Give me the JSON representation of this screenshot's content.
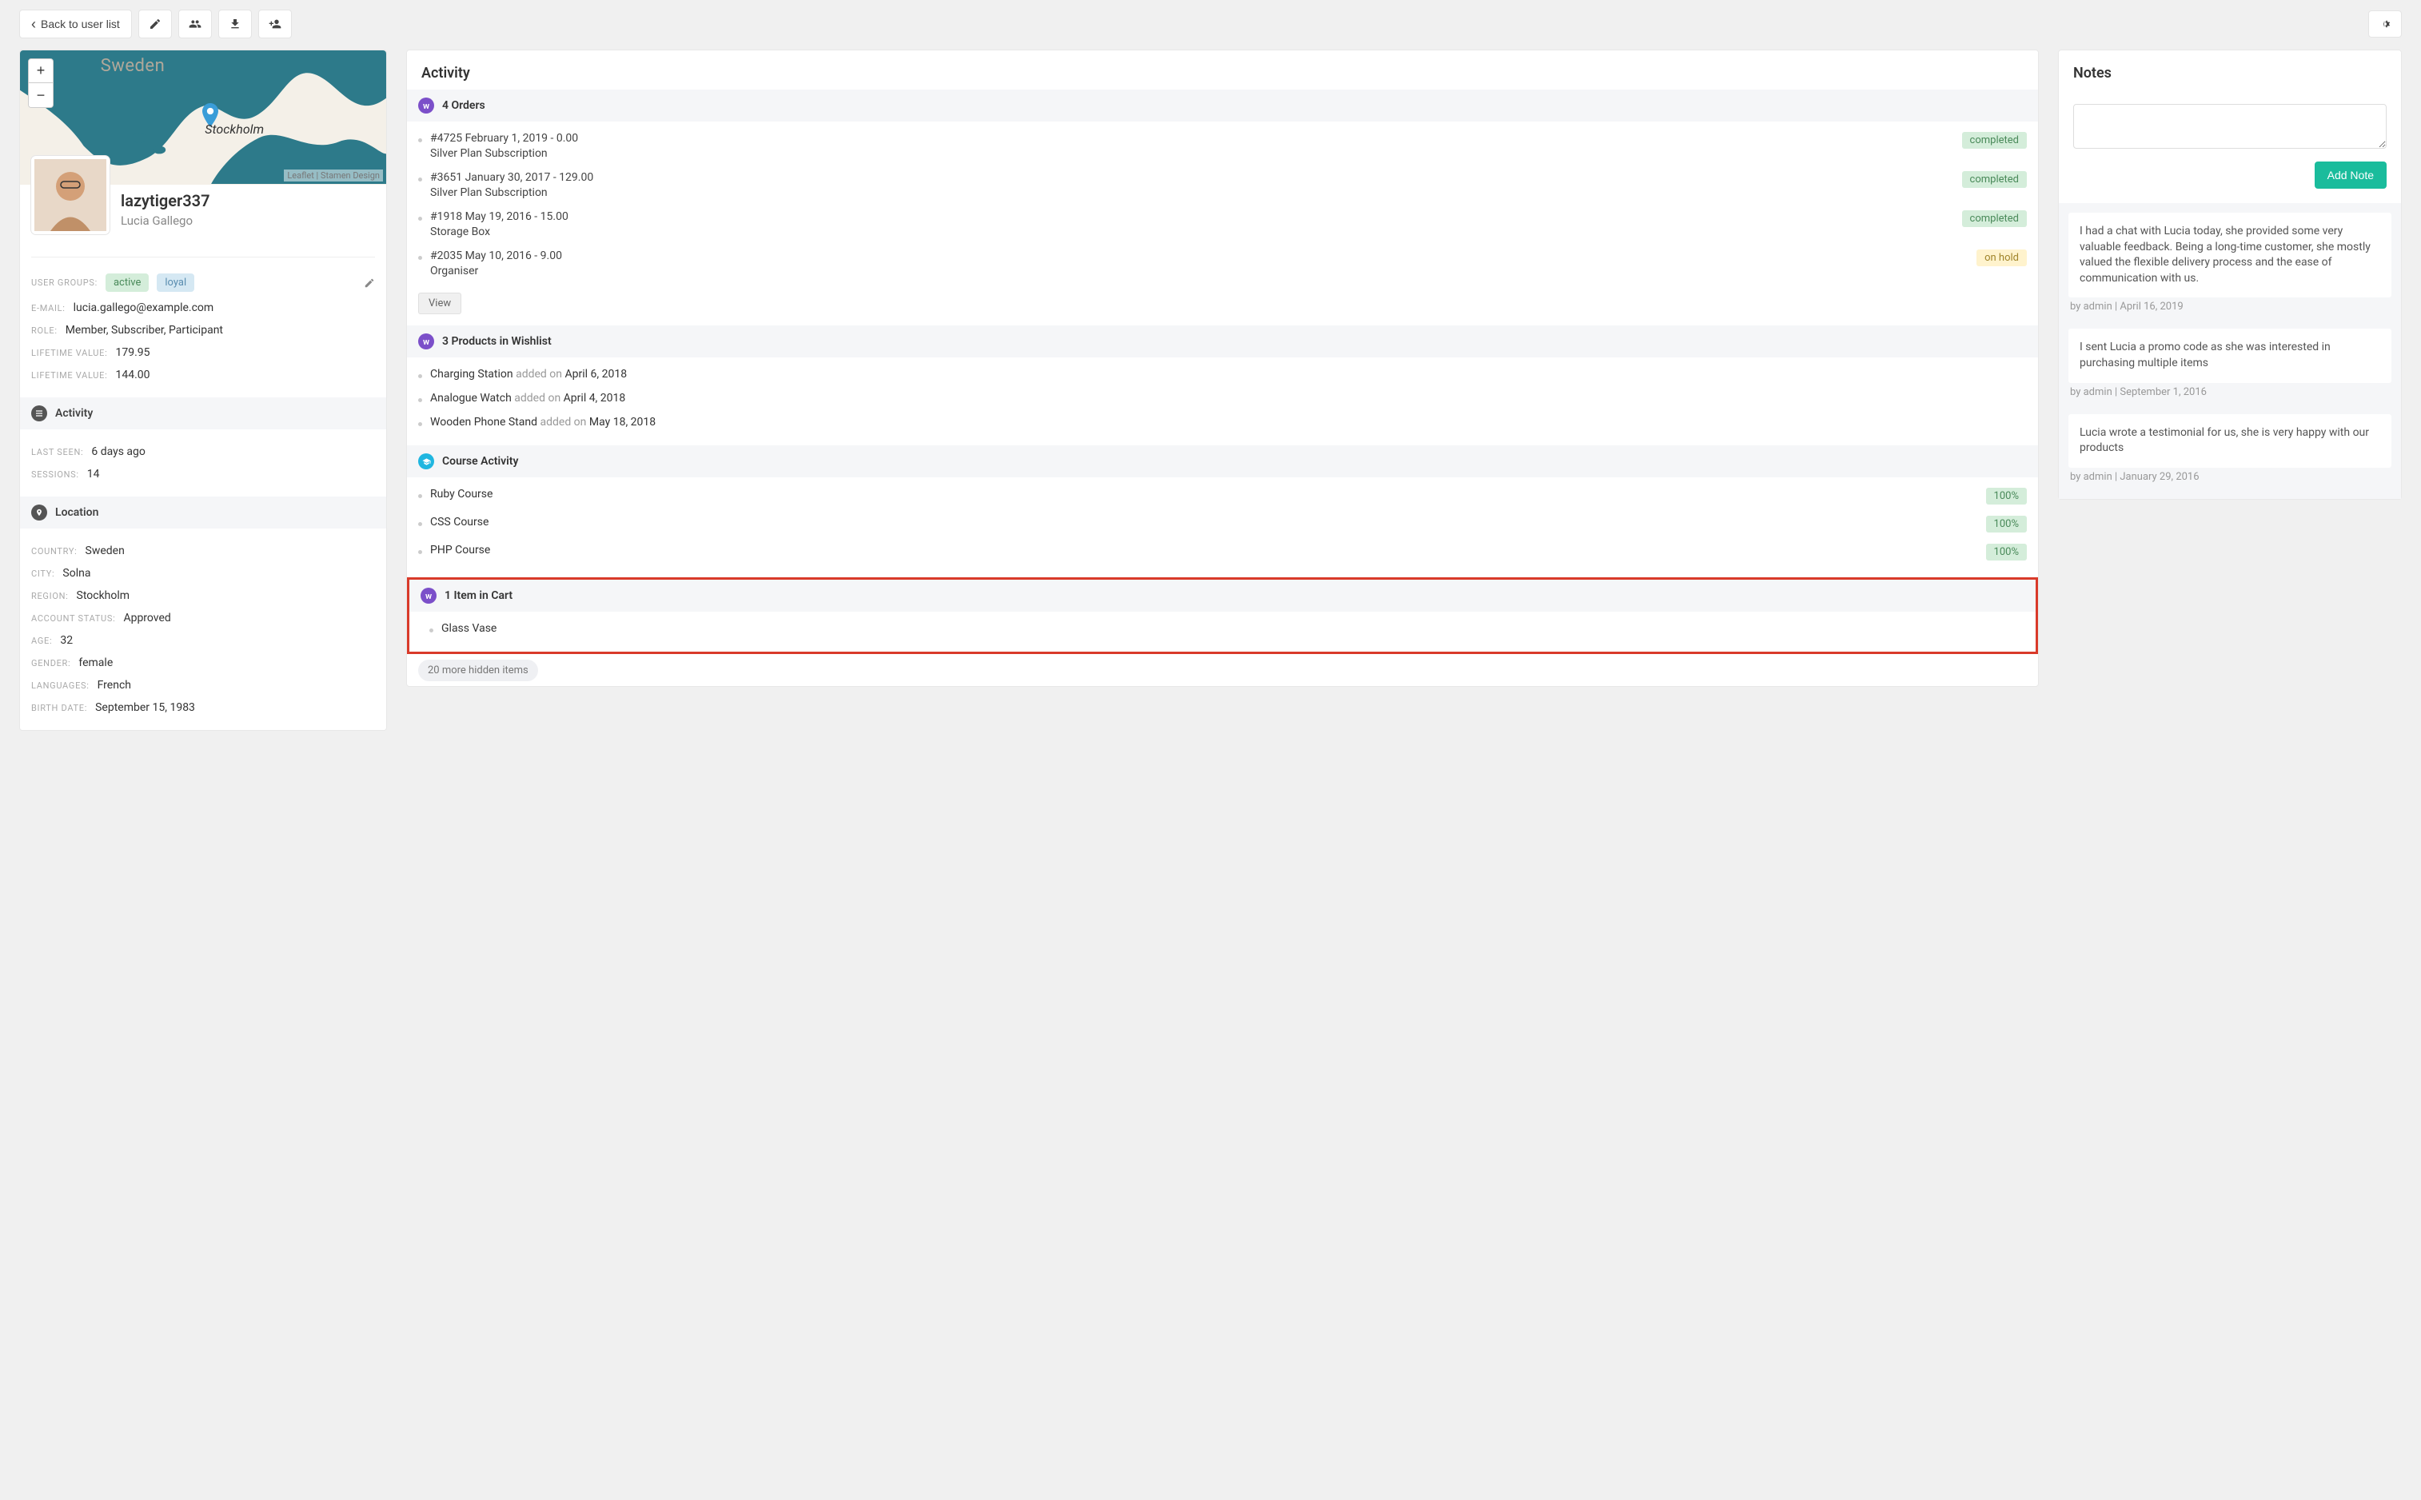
{
  "toolbar": {
    "back_label": "Back to user list"
  },
  "profile": {
    "map": {
      "country_label": "Sweden",
      "city_label": "Stockholm",
      "attribution": "Leaflet | Stamen Design"
    },
    "username": "lazytiger337",
    "fullname": "Lucia Gallego",
    "user_groups_label": "USER GROUPS:",
    "groups": {
      "active": "active",
      "loyal": "loyal"
    },
    "email_label": "E-MAIL:",
    "email": "lucia.gallego@example.com",
    "role_label": "ROLE:",
    "role": "Member, Subscriber, Participant",
    "lifetime_value_label": "LIFETIME VALUE:",
    "lifetime_value_1": "179.95",
    "lifetime_value_2": "144.00",
    "activity_header": "Activity",
    "last_seen_label": "LAST SEEN:",
    "last_seen": "6 days ago",
    "sessions_label": "SESSIONS:",
    "sessions": "14",
    "location_header": "Location",
    "country_label": "COUNTRY:",
    "country": "Sweden",
    "city_label": "CITY:",
    "city": "Solna",
    "region_label": "REGION:",
    "region": "Stockholm",
    "account_status_label": "ACCOUNT STATUS:",
    "account_status": "Approved",
    "age_label": "AGE:",
    "age": "32",
    "gender_label": "GENDER:",
    "gender": "female",
    "languages_label": "LANGUAGES:",
    "languages": "French",
    "birth_date_label": "BIRTH DATE:",
    "birth_date": "September 15, 1983"
  },
  "activity": {
    "title": "Activity",
    "orders_header": "4  Orders",
    "orders": [
      {
        "line1": "#4725 February 1, 2019 - 0.00",
        "line2": "Silver Plan Subscription",
        "status": "completed",
        "status_color": "green"
      },
      {
        "line1": "#3651 January 30, 2017 - 129.00",
        "line2": "Silver Plan Subscription",
        "status": "completed",
        "status_color": "green"
      },
      {
        "line1": "#1918 May 19, 2016 - 15.00",
        "line2": "Storage Box",
        "status": "completed",
        "status_color": "green"
      },
      {
        "line1": "#2035 May 10, 2016 - 9.00",
        "line2": "Organiser",
        "status": "on hold",
        "status_color": "yellow"
      }
    ],
    "view_label": "View",
    "wishlist_header": "3  Products in Wishlist",
    "wishlist": [
      {
        "name": "Charging Station",
        "added": "added on",
        "date": "April 6, 2018"
      },
      {
        "name": "Analogue Watch",
        "added": "added on",
        "date": "April 4, 2018"
      },
      {
        "name": "Wooden Phone Stand",
        "added": "added on",
        "date": "May 18, 2018"
      }
    ],
    "courses_header": "Course Activity",
    "courses": [
      {
        "name": "Ruby Course",
        "pct": "100%"
      },
      {
        "name": "CSS Course",
        "pct": "100%"
      },
      {
        "name": "PHP Course",
        "pct": "100%"
      }
    ],
    "cart_header": "1  Item in Cart",
    "cart": [
      {
        "name": "Glass Vase"
      }
    ],
    "more_hidden": "20 more hidden items"
  },
  "notes": {
    "title": "Notes",
    "add_button": "Add Note",
    "items": [
      {
        "text": "I had a chat with Lucia today, she provided some very valuable feedback. Being a long-time customer, she mostly valued the flexible delivery process and the ease of communication with us.",
        "meta": "by admin | April 16, 2019"
      },
      {
        "text": "I sent Lucia a promo code as she was interested in purchasing multiple items",
        "meta": "by admin | September 1, 2016"
      },
      {
        "text": "Lucia wrote a testimonial for us, she is very happy with our products",
        "meta": "by admin | January 29, 2016"
      }
    ]
  }
}
